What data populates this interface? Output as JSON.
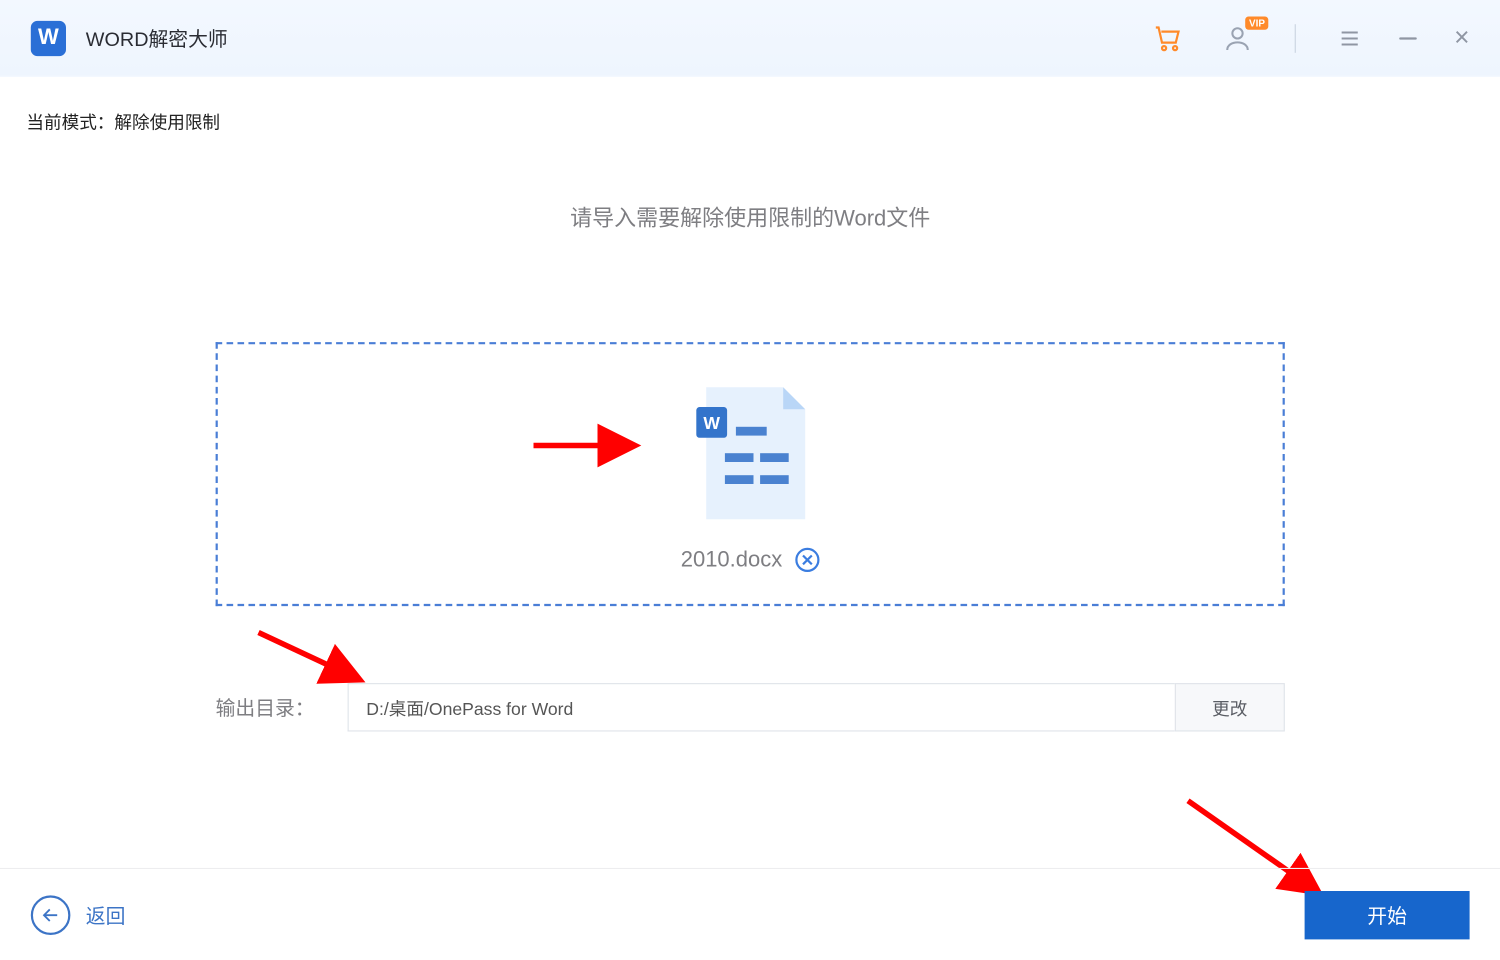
{
  "app": {
    "title": "WORD解密大师",
    "icon_letter": "W"
  },
  "titlebar": {
    "vip_badge": "VIP"
  },
  "mode": {
    "label_prefix": "当前模式：",
    "value": "解除使用限制"
  },
  "instruction": "请导入需要解除使用限制的Word文件",
  "dropzone": {
    "file": {
      "name": "2010.docx"
    }
  },
  "output": {
    "label": "输出目录：",
    "path": "D:/桌面/OnePass for Word",
    "change_label": "更改"
  },
  "footer": {
    "back_label": "返回",
    "start_label": "开始"
  }
}
